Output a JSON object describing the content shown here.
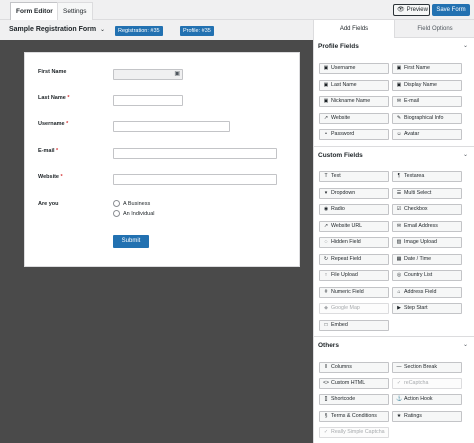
{
  "top": {
    "tabs": [
      "Form Editor",
      "Settings"
    ],
    "preview_label": "Preview",
    "save_label": "Save Form"
  },
  "title": {
    "form_name": "Sample Registration Form",
    "badge_registration": "Registration: #35",
    "badge_profile": "Profile: #35"
  },
  "form": {
    "first_name": "First Name",
    "last_name": "Last Name",
    "username": "Username",
    "email": "E-mail",
    "website": "Website",
    "are_you": "Are you",
    "option_a": "A Business",
    "option_b": "An Individual",
    "submit": "Submit",
    "required_mark": "*"
  },
  "panel": {
    "tab_add": "Add Fields",
    "tab_options": "Field Options",
    "profile_title": "Profile Fields",
    "custom_title": "Custom Fields",
    "others_title": "Others",
    "profile_fields": [
      "Username",
      "First Name",
      "Last Name",
      "Display Name",
      "Nickname Name",
      "E-mail",
      "Website",
      "Biographical Info",
      "Password",
      "Avatar"
    ],
    "custom_fields": [
      "Text",
      "Textarea",
      "Dropdown",
      "Multi Select",
      "Radio",
      "Checkbox",
      "Website URL",
      "Email Address",
      "Hidden Field",
      "Image Upload",
      "Repeat Field",
      "Date / Time",
      "File Upload",
      "Country List",
      "Numeric Field",
      "Address Field",
      "Google Map",
      "Step Start",
      "Embed"
    ],
    "others_fields": [
      "Columns",
      "Section Break",
      "Custom HTML",
      "reCaptcha",
      "Shortcode",
      "Action Hook",
      "Terms & Conditions",
      "Ratings",
      "Really Simple Captcha"
    ]
  }
}
